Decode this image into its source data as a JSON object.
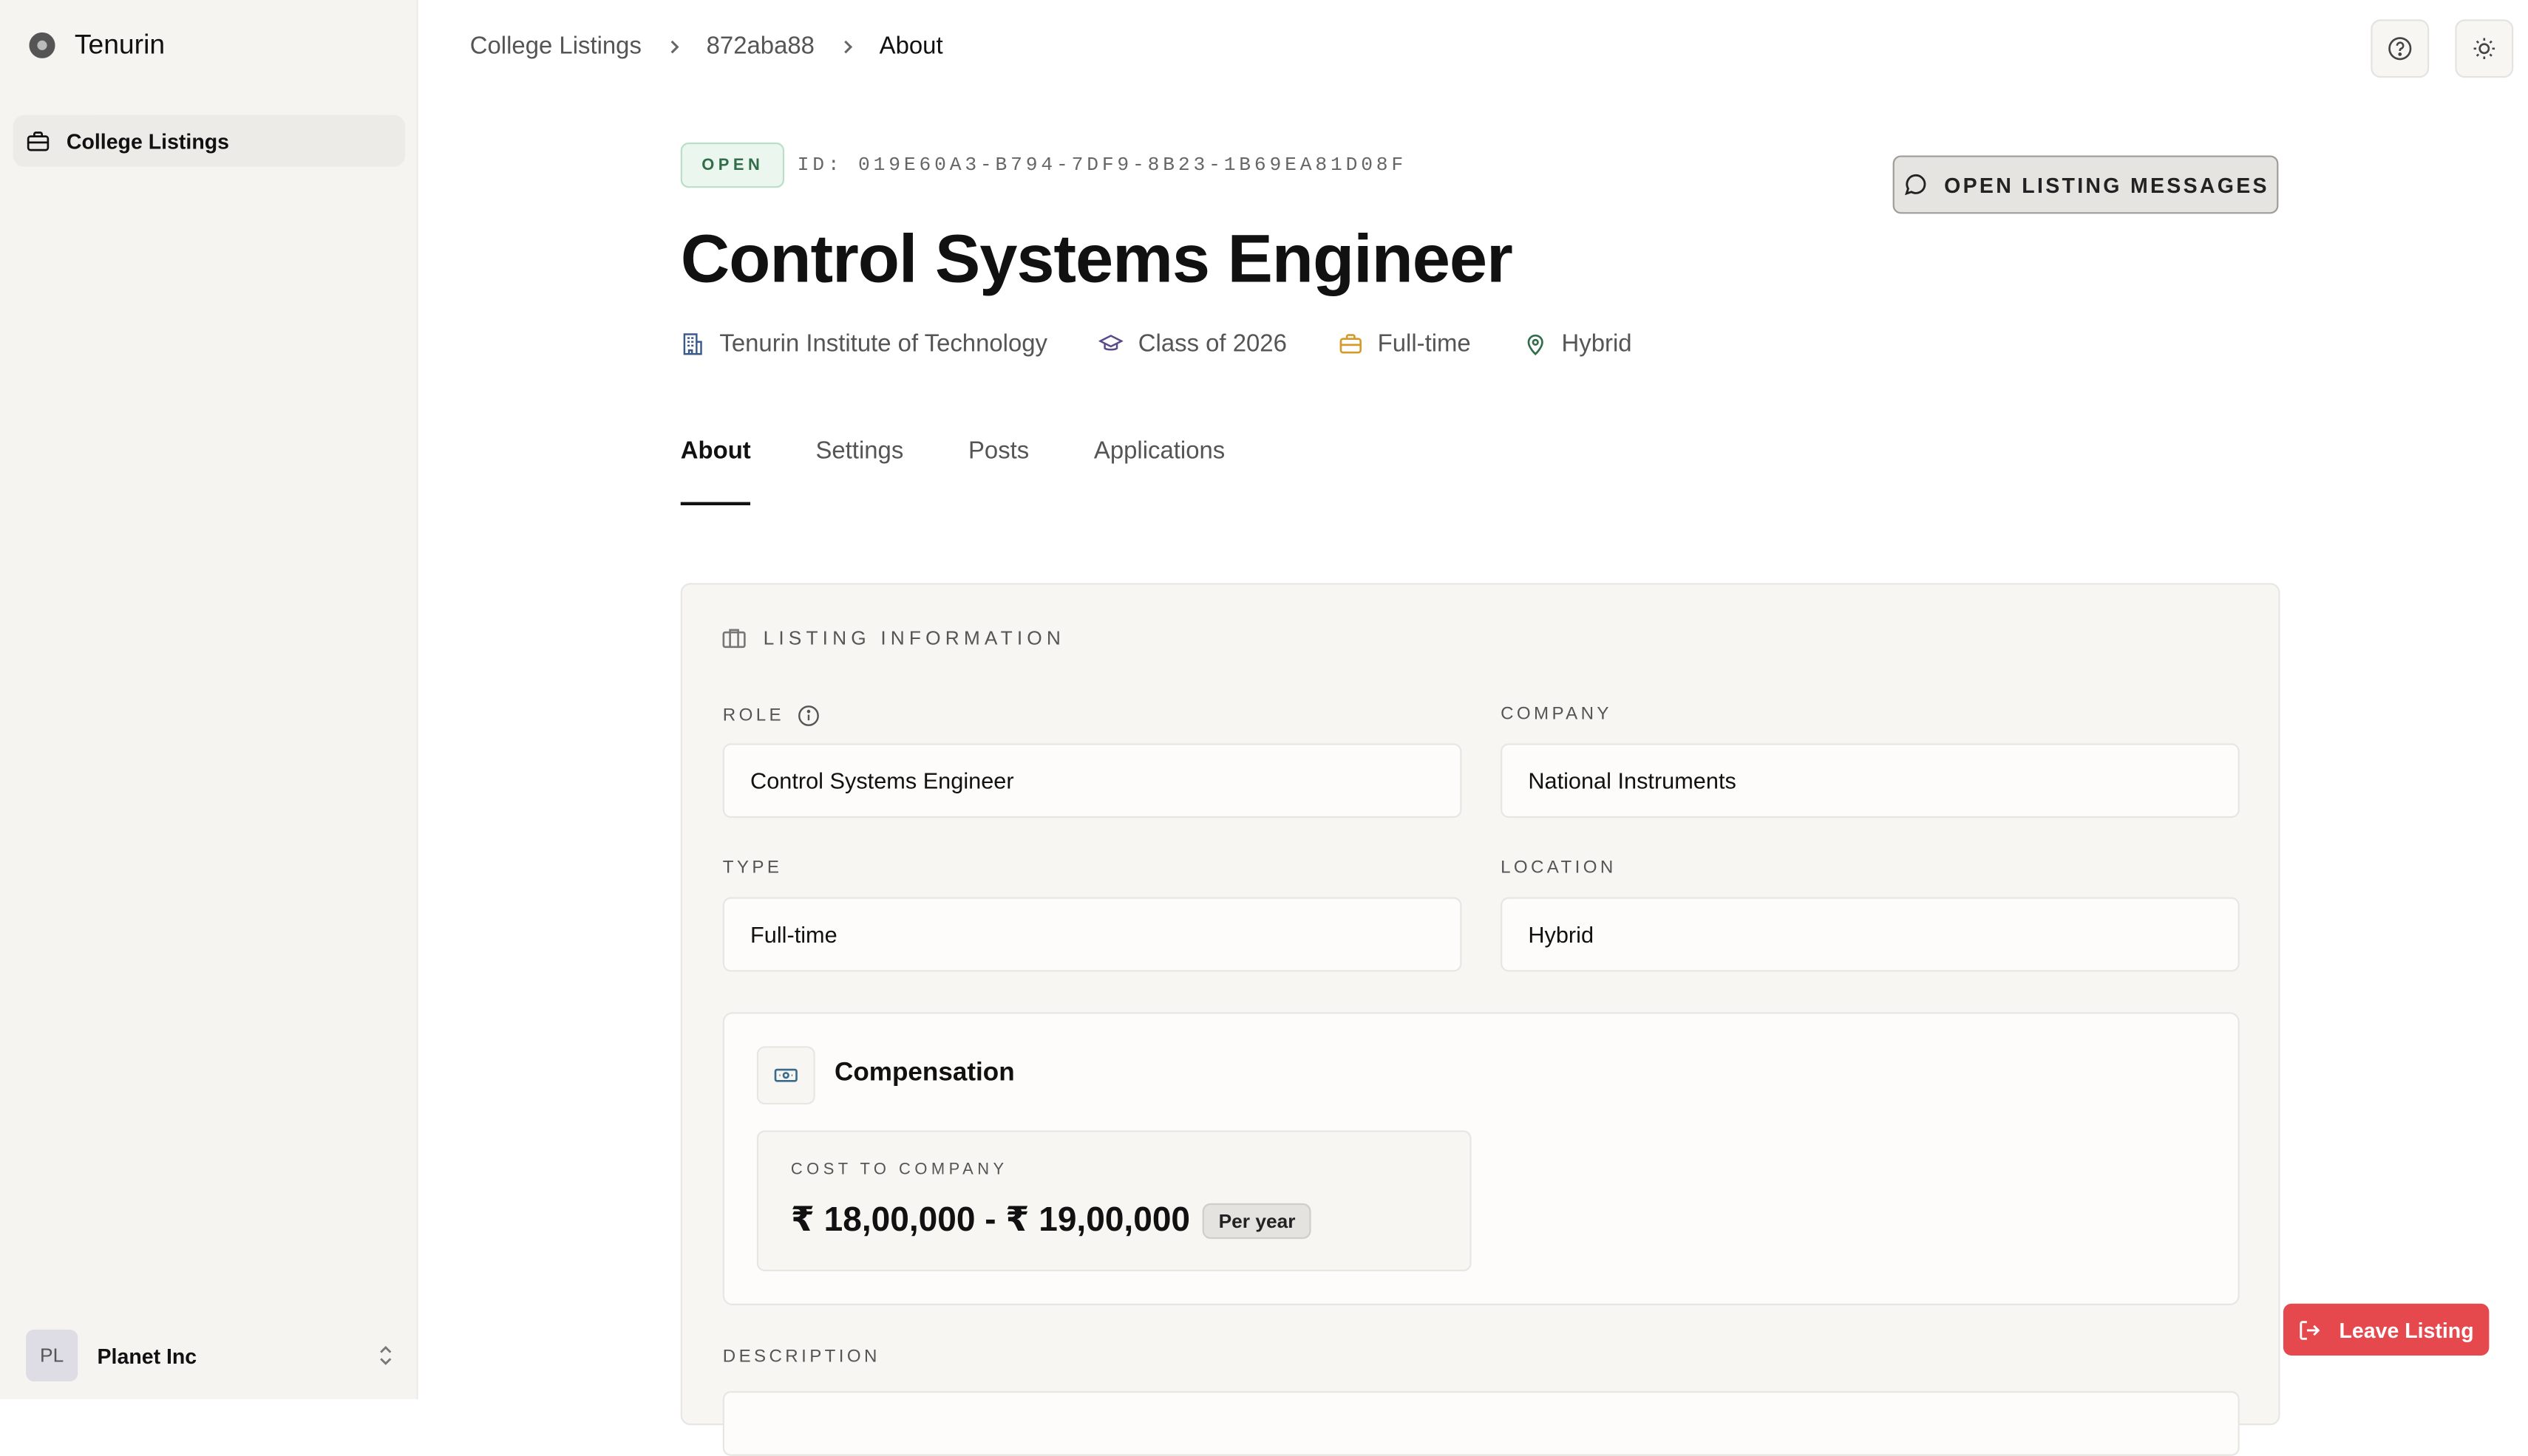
{
  "sidebar": {
    "brand": "Tenurin",
    "nav": [
      {
        "label": "College Listings",
        "icon": "briefcase-icon"
      }
    ],
    "account": {
      "initials": "PL",
      "name": "Planet Inc"
    }
  },
  "breadcrumb": [
    "College Listings",
    "872aba88",
    "About"
  ],
  "header": {
    "status": "OPEN",
    "listing_id": "ID: 019E60A3-B794-7DF9-8B23-1B69EA81D08F",
    "messages_button": "OPEN LISTING MESSAGES",
    "title": "Control Systems Engineer",
    "meta": {
      "institute": "Tenurin Institute of Technology",
      "class": "Class of 2026",
      "type": "Full-time",
      "location": "Hybrid"
    }
  },
  "tabs": [
    "About",
    "Settings",
    "Posts",
    "Applications"
  ],
  "active_tab": "About",
  "listing_info": {
    "heading": "LISTING INFORMATION",
    "role_label": "ROLE",
    "role_value": "Control Systems Engineer",
    "company_label": "COMPANY",
    "company_value": "National Instruments",
    "type_label": "TYPE",
    "type_value": "Full-time",
    "location_label": "LOCATION",
    "location_value": "Hybrid",
    "compensation": {
      "title": "Compensation",
      "ctc_label": "COST TO COMPANY",
      "ctc_value": "₹ 18,00,000 - ₹ 19,00,000",
      "period": "Per year"
    },
    "description_label": "DESCRIPTION"
  },
  "leave_button": "Leave Listing",
  "colors": {
    "accent_red": "#e5484d",
    "open_green": "#2f6e48",
    "sidebar_bg": "#f5f4f1"
  }
}
